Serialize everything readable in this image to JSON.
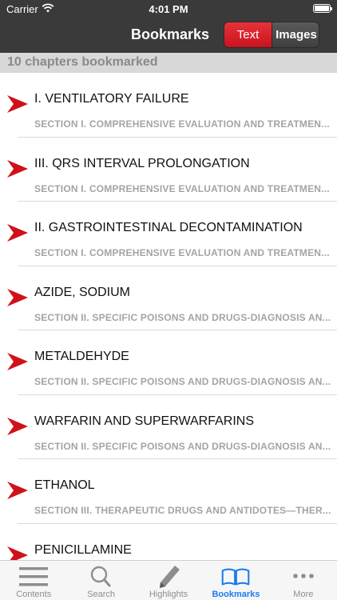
{
  "status_bar": {
    "carrier": "Carrier",
    "time": "4:01 PM"
  },
  "nav": {
    "title": "Bookmarks",
    "segments": {
      "text": "Text",
      "images": "Images"
    }
  },
  "section_header": "10 chapters bookmarked",
  "bookmarks": [
    {
      "title": "I. VENTILATORY FAILURE",
      "subtitle": "SECTION I. COMPREHENSIVE EVALUATION AND TREATMEN..."
    },
    {
      "title": "III. QRS INTERVAL PROLONGATION",
      "subtitle": "SECTION I. COMPREHENSIVE EVALUATION AND TREATMEN..."
    },
    {
      "title": "II. GASTROINTESTINAL DECONTAMINATION",
      "subtitle": "SECTION I. COMPREHENSIVE EVALUATION AND TREATMEN..."
    },
    {
      "title": "AZIDE, SODIUM",
      "subtitle": "SECTION II. SPECIFIC POISONS AND DRUGS-DIAGNOSIS AN..."
    },
    {
      "title": "METALDEHYDE",
      "subtitle": "SECTION II. SPECIFIC POISONS AND DRUGS-DIAGNOSIS AN..."
    },
    {
      "title": "WARFARIN AND SUPERWARFARINS",
      "subtitle": "SECTION II. SPECIFIC POISONS AND DRUGS-DIAGNOSIS AN..."
    },
    {
      "title": "ETHANOL",
      "subtitle": "SECTION III. THERAPEUTIC DRUGS AND ANTIDOTES—THER..."
    },
    {
      "title": "PENICILLAMINE",
      "subtitle": ""
    }
  ],
  "tabs": [
    {
      "label": "Contents",
      "icon": "contents-icon"
    },
    {
      "label": "Search",
      "icon": "search-icon"
    },
    {
      "label": "Highlights",
      "icon": "highlighter-icon"
    },
    {
      "label": "Bookmarks",
      "icon": "bookmarks-icon"
    },
    {
      "label": "More",
      "icon": "more-icon"
    }
  ],
  "colors": {
    "accent_red": "#d0101a",
    "active_tab": "#1a7cf0",
    "nav_bg": "#3a3a3a"
  }
}
